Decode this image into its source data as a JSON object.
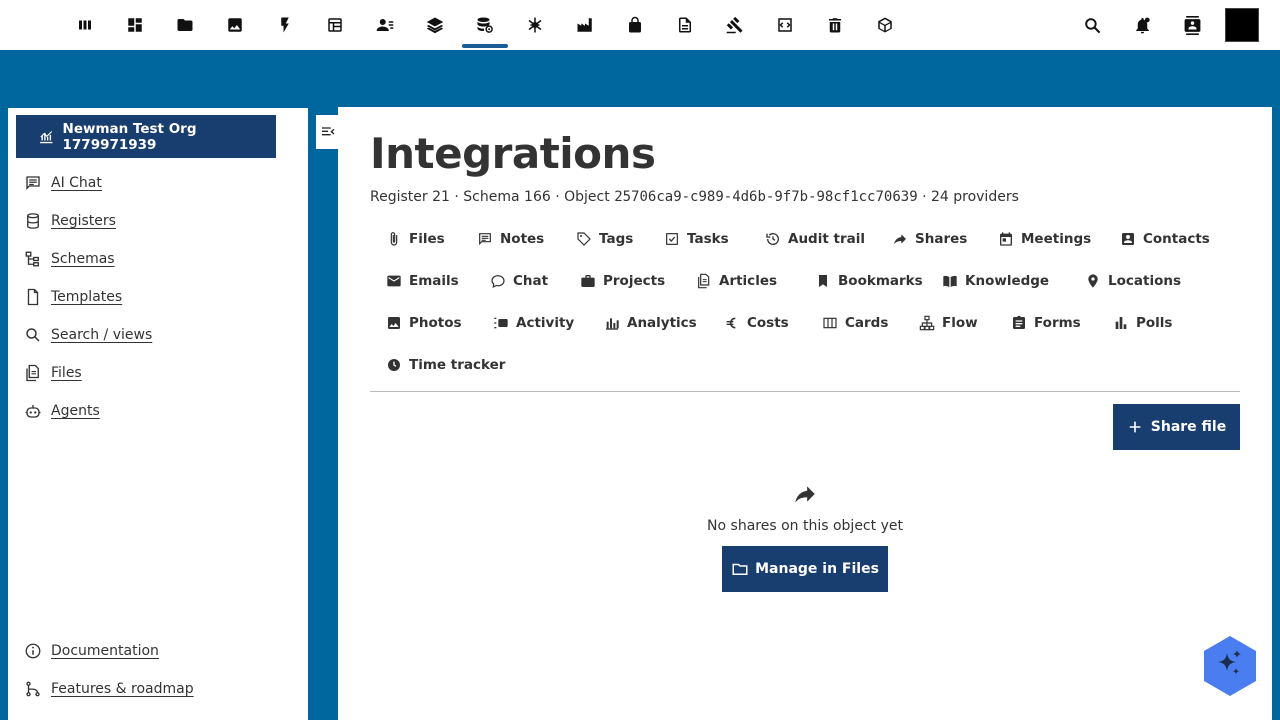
{
  "topbar": {
    "apps": [
      {
        "icon": "dashboard-columns-icon",
        "name": "Dashboard"
      },
      {
        "icon": "apps-grid-icon",
        "name": "Apps"
      },
      {
        "icon": "folder-icon",
        "name": "Files"
      },
      {
        "icon": "image-icon",
        "name": "Photos"
      },
      {
        "icon": "lightning-icon",
        "name": "Activity"
      },
      {
        "icon": "table-icon",
        "name": "Tables"
      },
      {
        "icon": "contact-list-icon",
        "name": "Contacts"
      },
      {
        "icon": "layers-icon",
        "name": "Stack"
      },
      {
        "icon": "database-gear-icon",
        "name": "Registers",
        "active": true
      },
      {
        "icon": "network-bug-icon",
        "name": "Network"
      },
      {
        "icon": "factory-icon",
        "name": "Factory"
      },
      {
        "icon": "lock-icon",
        "name": "Passwords"
      },
      {
        "icon": "document-icon",
        "name": "Documents"
      },
      {
        "icon": "gavel-icon",
        "name": "Legal"
      },
      {
        "icon": "code-window-icon",
        "name": "Developer"
      },
      {
        "icon": "trash-icon",
        "name": "Deleted"
      },
      {
        "icon": "cube-icon",
        "name": "Objects"
      }
    ],
    "right": {
      "search_icon": "search-icon",
      "notifications_icon": "bell-icon",
      "contacts_icon": "contacts-book-icon"
    }
  },
  "sidebar": {
    "org_label": "Newman Test Org 1779971939",
    "items": [
      {
        "label": "AI Chat",
        "icon": "chat-icon"
      },
      {
        "label": "Registers",
        "icon": "database-icon"
      },
      {
        "label": "Schemas",
        "icon": "schema-tree-icon"
      },
      {
        "label": "Templates",
        "icon": "file-icon"
      },
      {
        "label": "Search / views",
        "icon": "search-icon"
      },
      {
        "label": "Files",
        "icon": "files-icon"
      },
      {
        "label": "Agents",
        "icon": "robot-icon"
      }
    ],
    "footer": [
      {
        "label": "Documentation",
        "icon": "info-icon"
      },
      {
        "label": "Features & roadmap",
        "icon": "roadmap-icon"
      }
    ]
  },
  "main": {
    "title": "Integrations",
    "meta": {
      "register_label": "Register",
      "register_value": "21",
      "schema_label": "Schema",
      "schema_value": "166",
      "object_label": "Object",
      "object_value": "25706ca9-c989-4d6b-9f7b-98cf1cc70639",
      "providers": "24 providers",
      "separator": "·"
    },
    "tabs": [
      {
        "label": "Files",
        "icon": "paperclip-icon"
      },
      {
        "label": "Notes",
        "icon": "note-icon"
      },
      {
        "label": "Tags",
        "icon": "tag-icon"
      },
      {
        "label": "Tasks",
        "icon": "checkbox-icon"
      },
      {
        "label": "Audit trail",
        "icon": "history-icon"
      },
      {
        "label": "Shares",
        "icon": "share-arrow-icon"
      },
      {
        "label": "Meetings",
        "icon": "calendar-icon"
      },
      {
        "label": "Contacts",
        "icon": "contact-card-icon"
      },
      {
        "label": "Emails",
        "icon": "email-icon"
      },
      {
        "label": "Chat",
        "icon": "chat-bubble-icon"
      },
      {
        "label": "Projects",
        "icon": "briefcase-icon"
      },
      {
        "label": "Articles",
        "icon": "article-icon"
      },
      {
        "label": "Bookmarks",
        "icon": "bookmark-icon"
      },
      {
        "label": "Knowledge",
        "icon": "book-open-icon"
      },
      {
        "label": "Locations",
        "icon": "location-pin-icon"
      },
      {
        "label": "Photos",
        "icon": "photo-icon"
      },
      {
        "label": "Activity",
        "icon": "activity-list-icon"
      },
      {
        "label": "Analytics",
        "icon": "analytics-icon"
      },
      {
        "label": "Costs",
        "icon": "euro-icon"
      },
      {
        "label": "Cards",
        "icon": "cards-icon"
      },
      {
        "label": "Flow",
        "icon": "flow-icon"
      },
      {
        "label": "Forms",
        "icon": "clipboard-icon"
      },
      {
        "label": "Polls",
        "icon": "poll-icon"
      },
      {
        "label": "Time tracker",
        "icon": "clock-icon"
      }
    ],
    "share_button_label": "Share file",
    "empty_text": "No shares on this object yet",
    "manage_button_label": "Manage in Files"
  },
  "colors": {
    "background": "#00679e",
    "primary": "#173e6e",
    "active_indicator": "#1a5c96",
    "fab": "#4a7ef0"
  }
}
